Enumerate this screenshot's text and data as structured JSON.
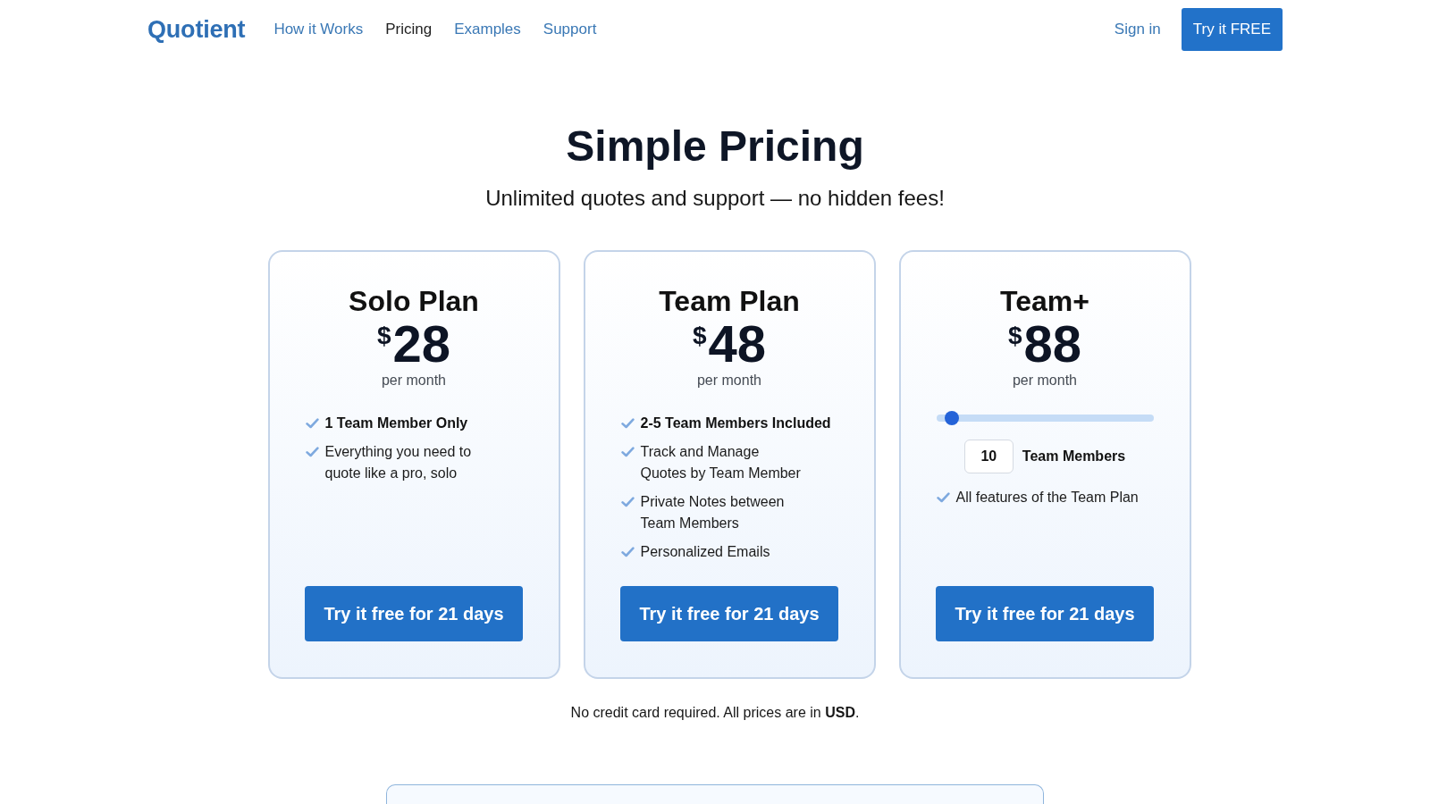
{
  "nav": {
    "logo": "Quotient",
    "links": [
      {
        "label": "How it Works",
        "selected": false
      },
      {
        "label": "Pricing",
        "selected": true
      },
      {
        "label": "Examples",
        "selected": false
      },
      {
        "label": "Support",
        "selected": false
      }
    ],
    "sign_in": "Sign in",
    "cta": "Try it FREE"
  },
  "hero": {
    "title": "Simple Pricing",
    "subtitle": "Unlimited quotes and support — no hidden fees!"
  },
  "plans": [
    {
      "kind": "fixed",
      "name": "Solo Plan",
      "currency": "$",
      "price": "28",
      "period": "per month",
      "features": [
        {
          "text": "1 Team Member Only",
          "bold": true
        },
        {
          "text": "Everything you need to\nquote like a pro, solo",
          "bold": false
        }
      ],
      "button": "Try it free for 21 days"
    },
    {
      "kind": "fixed",
      "name": "Team Plan",
      "currency": "$",
      "price": "48",
      "period": "per month",
      "features": [
        {
          "text": "2-5 Team Members Included",
          "bold": true
        },
        {
          "text": "Track and Manage\nQuotes by Team Member",
          "bold": false
        },
        {
          "text": "Private Notes between\nTeam Members",
          "bold": false
        },
        {
          "text": "Personalized Emails",
          "bold": false
        }
      ],
      "button": "Try it free for 21 days"
    },
    {
      "kind": "slider",
      "name": "Team+",
      "currency": "$",
      "price": "88",
      "period": "per month",
      "slider": {
        "level": 0.07
      },
      "members": {
        "value": "10",
        "label": "Team Members"
      },
      "features": [
        {
          "text": "All features of the Team Plan",
          "bold": false
        }
      ],
      "button": "Try it free for 21 days"
    }
  ],
  "note": "No credit card required. All prices are in **USD**."
}
